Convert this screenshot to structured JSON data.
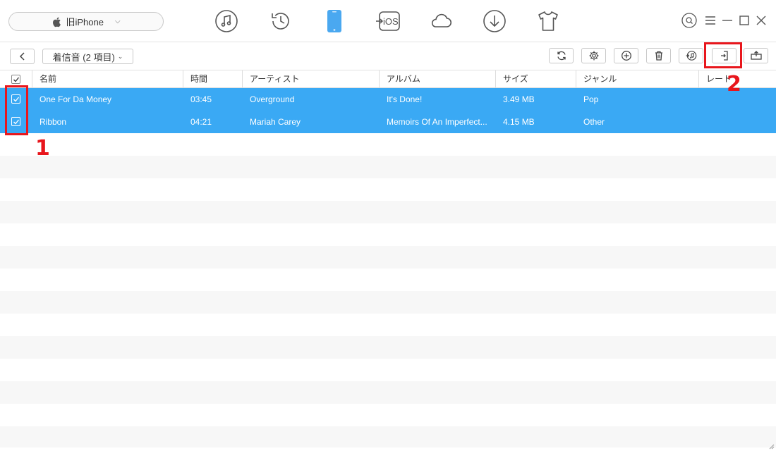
{
  "device": {
    "name": "旧iPhone"
  },
  "nav_icons": [
    "music-icon",
    "history-icon",
    "phone-icon",
    "ios-transfer-icon",
    "cloud-icon",
    "download-icon",
    "tshirt-icon"
  ],
  "nav_ios_label": "iOS",
  "toolbar": {
    "category": "着信音 (2 項目)",
    "buttons": [
      "refresh-icon",
      "settings-icon",
      "add-icon",
      "delete-icon",
      "to-itunes-icon",
      "to-computer-icon",
      "to-device-icon"
    ]
  },
  "table": {
    "columns": [
      "名前",
      "時間",
      "アーティスト",
      "アルバム",
      "サイズ",
      "ジャンル",
      "レート"
    ],
    "rows": [
      {
        "name": "One For Da Money",
        "time": "03:45",
        "artist": "Overground",
        "album": "It's Done!",
        "size": "3.49 MB",
        "genre": "Pop",
        "rating": "",
        "checked": true
      },
      {
        "name": "Ribbon",
        "time": "04:21",
        "artist": "Mariah Carey",
        "album": "Memoirs Of An Imperfect...",
        "size": "4.15 MB",
        "genre": "Other",
        "rating": "",
        "checked": true
      }
    ]
  },
  "annotations": [
    {
      "label": "1"
    },
    {
      "label": "2"
    }
  ],
  "colors": {
    "selected_row": "#3aa9f4",
    "active_nav": "#4aa8f0",
    "annotation": "#e8161c",
    "stripe": "#f7f7f7"
  }
}
